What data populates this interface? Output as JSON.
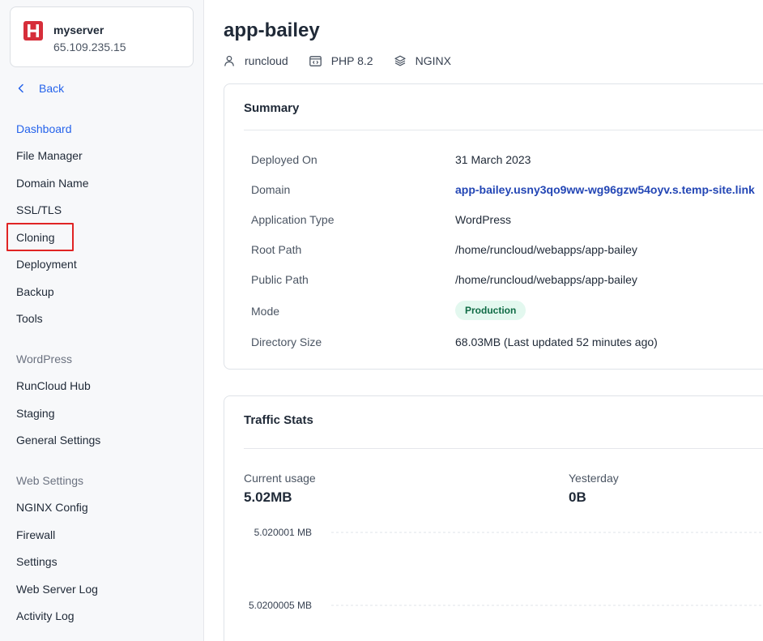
{
  "server": {
    "name": "myserver",
    "ip": "65.109.235.15",
    "logo_letter": "H",
    "logo_color": "#d62e3a"
  },
  "sidebar": {
    "back_label": "Back",
    "groups": [
      {
        "items": [
          "Dashboard",
          "File Manager",
          "Domain Name",
          "SSL/TLS",
          "Cloning",
          "Deployment",
          "Backup",
          "Tools"
        ]
      },
      {
        "heading": "WordPress",
        "items": [
          "RunCloud Hub",
          "Staging",
          "General Settings"
        ]
      },
      {
        "heading": "Web Settings",
        "items": [
          "NGINX Config",
          "Firewall",
          "Settings",
          "Web Server Log",
          "Activity Log"
        ]
      }
    ],
    "active_item": "Dashboard",
    "highlighted_item": "Cloning"
  },
  "app": {
    "title": "app-bailey",
    "meta": {
      "user": "runcloud",
      "php": "PHP 8.2",
      "server": "NGINX"
    }
  },
  "summary": {
    "title": "Summary",
    "rows": [
      {
        "label": "Deployed On",
        "value": "31 March 2023"
      },
      {
        "label": "Domain",
        "value": "app-bailey.usny3qo9ww-wg96gzw54oyv.s.temp-site.link"
      },
      {
        "label": "Application Type",
        "value": "WordPress"
      },
      {
        "label": "Root Path",
        "value": "/home/runcloud/webapps/app-bailey"
      },
      {
        "label": "Public Path",
        "value": "/home/runcloud/webapps/app-bailey"
      },
      {
        "label": "Mode",
        "value": "Production"
      },
      {
        "label": "Directory Size",
        "value": "68.03MB (Last updated 52 minutes ago)"
      }
    ]
  },
  "traffic": {
    "title": "Traffic Stats",
    "current_usage_label": "Current usage",
    "current_usage_value": "5.02MB",
    "yesterday_label": "Yesterday",
    "yesterday_value": "0B"
  },
  "chart_data": {
    "type": "line",
    "title": "",
    "xlabel": "",
    "ylabel": "",
    "y_ticks": [
      "5.020001 MB",
      "5.0200005 MB"
    ],
    "y_tick_values": [
      5.020001,
      5.0200005
    ],
    "grid": "dashed horizontal",
    "series": []
  },
  "colors": {
    "accent": "#2563eb",
    "link": "#2346b5",
    "badge_bg": "#e3f8ef",
    "badge_text": "#0f6b45",
    "highlight": "#e02424"
  }
}
